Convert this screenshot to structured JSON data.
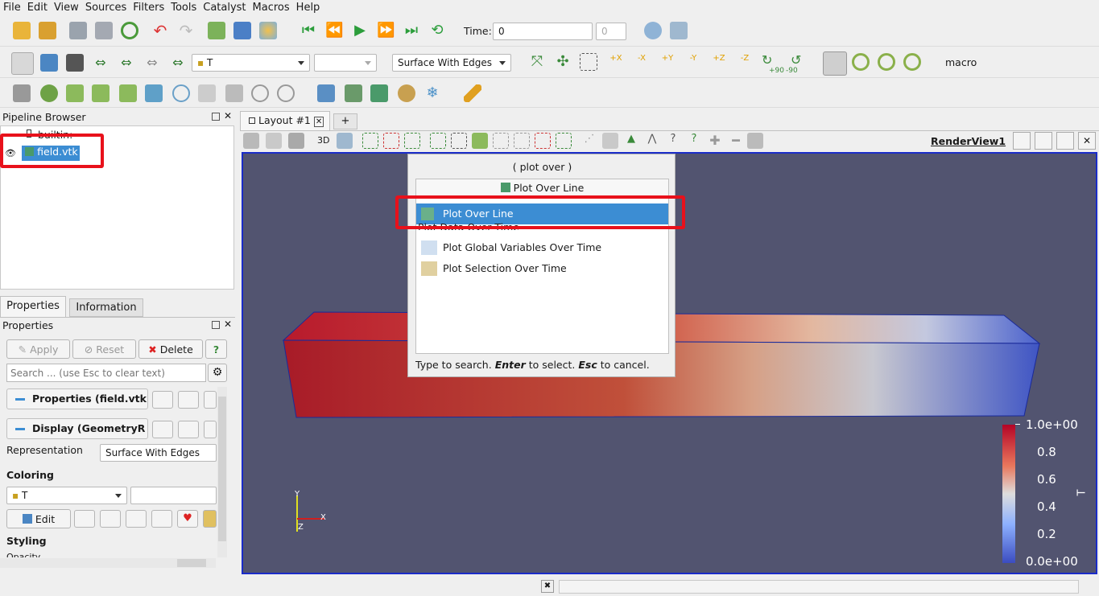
{
  "menu": [
    "File",
    "Edit",
    "View",
    "Sources",
    "Filters",
    "Tools",
    "Catalyst",
    "Macros",
    "Help"
  ],
  "time": {
    "label": "Time:",
    "value": "0",
    "step": "0"
  },
  "toolbar2": {
    "array_select": "T",
    "component_select": "",
    "representation": "Surface With Edges",
    "macro_label": "macro",
    "axis_buttons": [
      {
        "label": "+X",
        "color": "#e0a000"
      },
      {
        "label": "-X",
        "color": "#e0a000"
      },
      {
        "label": "+Y",
        "color": "#e0a000"
      },
      {
        "label": "-Y",
        "color": "#e0a000"
      },
      {
        "label": "+Z",
        "color": "#e0a000"
      },
      {
        "label": "-Z",
        "color": "#e0a000"
      }
    ],
    "rot_labels": [
      "+90",
      "-90"
    ]
  },
  "pipeline": {
    "title": "Pipeline Browser",
    "root": "builtin:",
    "item": "field.vtk"
  },
  "tabs": {
    "properties": "Properties",
    "information": "Information"
  },
  "props": {
    "title": "Properties",
    "apply": "Apply",
    "reset": "Reset",
    "delete": "Delete",
    "help": "?",
    "search_placeholder": "Search ... (use Esc to clear text)",
    "section1": "Properties (field.vtk",
    "section2": "Display (GeometryR",
    "representation_label": "Representation",
    "representation_value": "Surface With Edges",
    "coloring": "Coloring",
    "color_array": "T",
    "edit": "Edit",
    "styling": "Styling",
    "opacity": "Opacity"
  },
  "layout": {
    "tab": "Layout #1",
    "add": "+",
    "view_name": "RenderView1",
    "btn_3d": "3D"
  },
  "search_popup": {
    "header": "( plot over )",
    "pinned": "Plot Over Line",
    "items": [
      "Plot Over Line",
      "Plot Data Over Time",
      "Plot Global Variables Over Time",
      "Plot Selection Over Time"
    ],
    "footer_pre": "Type to search. ",
    "enter": "Enter",
    "footer_mid": " to select. ",
    "esc": "Esc",
    "footer_post": " to cancel."
  },
  "colorbar": {
    "labels": [
      "1.0e+00",
      "0.8",
      "0.6",
      "0.4",
      "0.2",
      "0.0e+00"
    ],
    "title": "T",
    "top_color": "#b40426",
    "mid_color": "#dddddd",
    "bottom_color": "#3b4cc0"
  },
  "axes": {
    "y": "Y",
    "x": "X",
    "z": "Z"
  },
  "colors": {
    "selection": "#3c8dd3",
    "highlight": "#e8111b",
    "view_bg": "#525470"
  }
}
